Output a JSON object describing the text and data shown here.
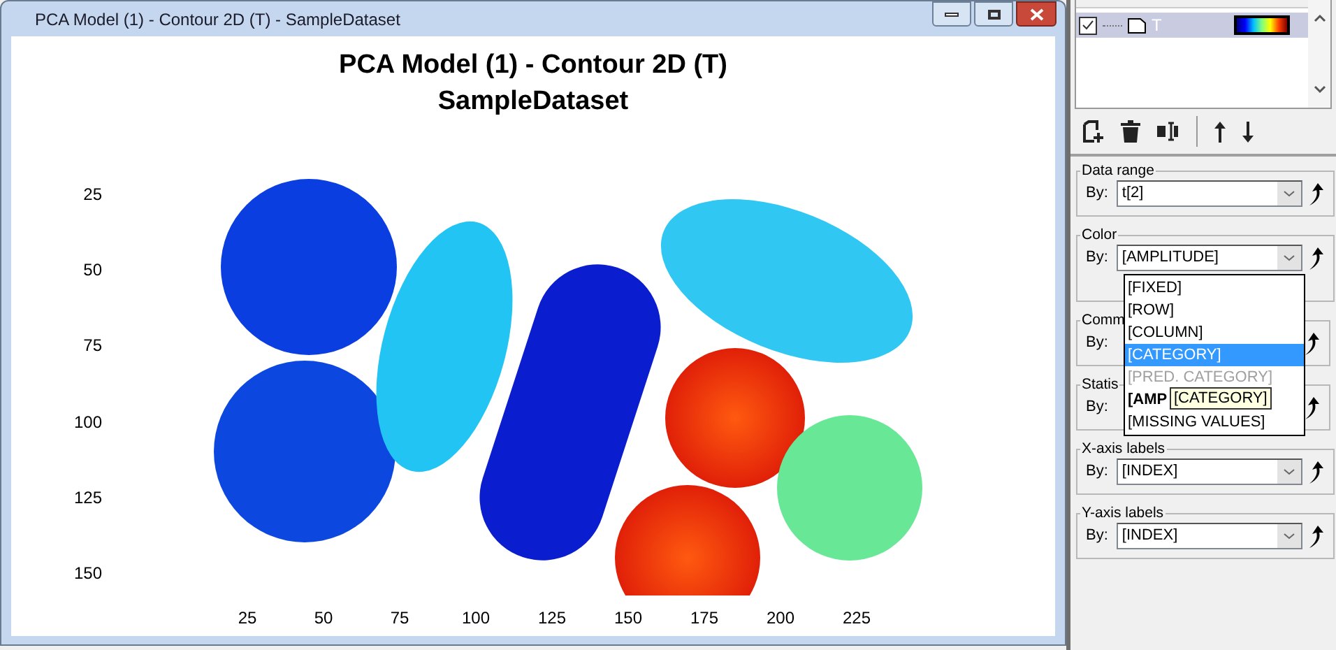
{
  "window": {
    "title": "PCA Model (1) - Contour 2D (T) - SampleDataset"
  },
  "plot": {
    "title": "PCA Model (1) - Contour 2D (T)",
    "subtitle": "SampleDataset",
    "xticks": [
      "25",
      "50",
      "75",
      "100",
      "125",
      "150",
      "175",
      "200",
      "225"
    ],
    "yticks": [
      "25",
      "50",
      "75",
      "100",
      "125",
      "150"
    ]
  },
  "layers": [
    {
      "name": "T",
      "checked": true,
      "selected": true
    }
  ],
  "groups": [
    {
      "label": "Data range",
      "by": "By:",
      "value": "t[2]",
      "open": false,
      "hidden": false
    },
    {
      "label": "Color",
      "by": "By:",
      "value": "[AMPLITUDE]",
      "open": true,
      "hidden": false
    },
    {
      "label": "Comm",
      "by": "By:",
      "open": false,
      "hidden": true
    },
    {
      "label": "Statis",
      "by": "By:",
      "open": false,
      "hidden": true
    },
    {
      "label": "X-axis labels",
      "by": "By:",
      "value": "[INDEX]",
      "open": false,
      "hidden": false
    },
    {
      "label": "Y-axis labels",
      "by": "By:",
      "value": "[INDEX]",
      "open": false,
      "hidden": false
    }
  ],
  "dropdown": {
    "items": [
      {
        "label": "[FIXED]",
        "selected": false,
        "disabled": false,
        "current": false
      },
      {
        "label": "[ROW]",
        "selected": false,
        "disabled": false,
        "current": false
      },
      {
        "label": "[COLUMN]",
        "selected": false,
        "disabled": false,
        "current": false
      },
      {
        "label": "[CATEGORY]",
        "selected": true,
        "disabled": false,
        "current": false
      },
      {
        "label": "[PRED. CATEGORY]",
        "selected": false,
        "disabled": true,
        "current": false
      },
      {
        "label": "[AMP",
        "selected": false,
        "disabled": false,
        "current": true
      },
      {
        "label": "[MISSING VALUES]",
        "selected": false,
        "disabled": false,
        "current": false
      }
    ],
    "tooltip": "[CATEGORY]"
  }
}
